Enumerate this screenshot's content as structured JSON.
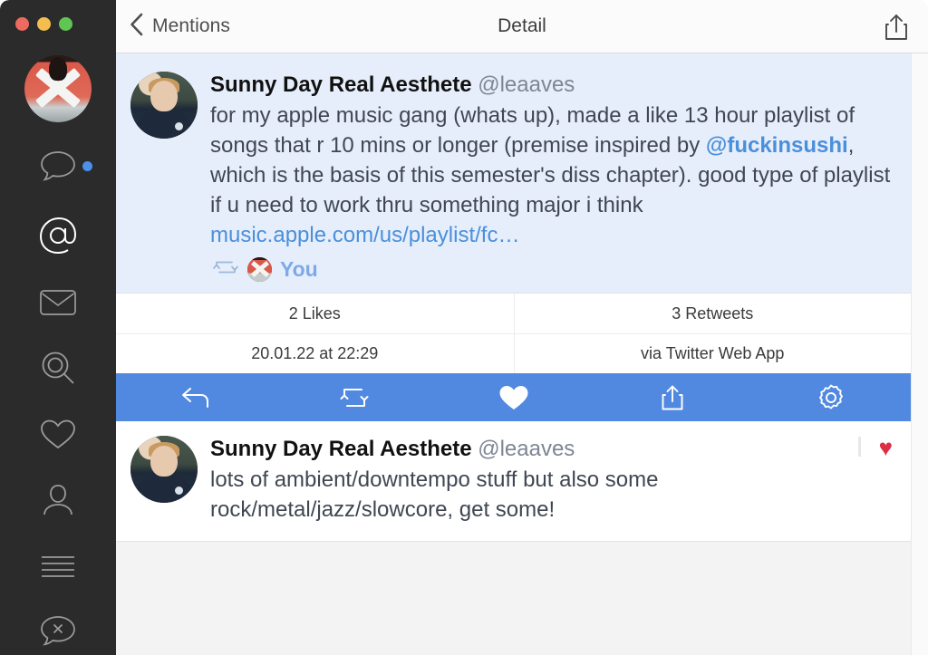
{
  "window": {
    "traffic_lights": [
      {
        "name": "close",
        "color": "#ec6a5f"
      },
      {
        "name": "minimize",
        "color": "#f4bd4f"
      },
      {
        "name": "zoom",
        "color": "#61c554"
      }
    ]
  },
  "sidebar": {
    "avatar_label": "account-avatar",
    "items": [
      {
        "icon": "speech-bubble-icon",
        "label": "Timeline",
        "active": false,
        "badge": true
      },
      {
        "icon": "at-sign-icon",
        "label": "Mentions",
        "active": true,
        "badge": false
      },
      {
        "icon": "envelope-icon",
        "label": "Messages",
        "active": false,
        "badge": false
      },
      {
        "icon": "search-icon",
        "label": "Search",
        "active": false,
        "badge": false
      },
      {
        "icon": "heart-icon",
        "label": "Likes",
        "active": false,
        "badge": false
      },
      {
        "icon": "person-icon",
        "label": "Profile",
        "active": false,
        "badge": false
      },
      {
        "icon": "list-lines-icon",
        "label": "Lists",
        "active": false,
        "badge": false
      },
      {
        "icon": "mute-bubble-icon",
        "label": "Muted",
        "active": false,
        "badge": false
      }
    ]
  },
  "titlebar": {
    "back_label": "Mentions",
    "title": "Detail",
    "back_icon": "chevron-left-icon",
    "share_icon": "share-icon"
  },
  "main_tweet": {
    "display_name": "Sunny Day Real Aesthete",
    "handle": "@leaaves",
    "text_part_1": "for my apple music gang (whats up), made a like 13 hour playlist of songs that r 10 mins or longer (premise inspired by ",
    "mention": "@fuckinsushi",
    "text_part_2": ", which is the basis of this semester's diss chapter). good type of playlist if u need to work thru something major i think ",
    "link": "music.apple.com/us/playlist/fc…",
    "retweet_icon": "retweet-icon",
    "retweeted_by": "You"
  },
  "stats": {
    "likes": "2 Likes",
    "retweets": "3 Retweets",
    "timestamp": "20.01.22 at 22:29",
    "source": "via Twitter Web App"
  },
  "action_bar": {
    "background": "#5189e0",
    "buttons": [
      {
        "icon": "reply-icon",
        "label": "Reply"
      },
      {
        "icon": "retweet-icon",
        "label": "Retweet"
      },
      {
        "icon": "heart-filled-icon",
        "label": "Like"
      },
      {
        "icon": "share-icon",
        "label": "Share"
      },
      {
        "icon": "gear-icon",
        "label": "Actions"
      }
    ]
  },
  "reply_tweet": {
    "display_name": "Sunny Day Real Aesthete",
    "handle": "@leaaves",
    "text": "lots of ambient/downtempo stuff but also some rock/metal/jazz/slowcore, get some!",
    "heart_emoji": "♥"
  },
  "colors": {
    "accent": "#5189e0",
    "main_tweet_bg": "#e6eefb",
    "link": "#4a8fdb",
    "sidebar_bg": "#2b2b2b",
    "heart_red": "#dd2e44"
  }
}
